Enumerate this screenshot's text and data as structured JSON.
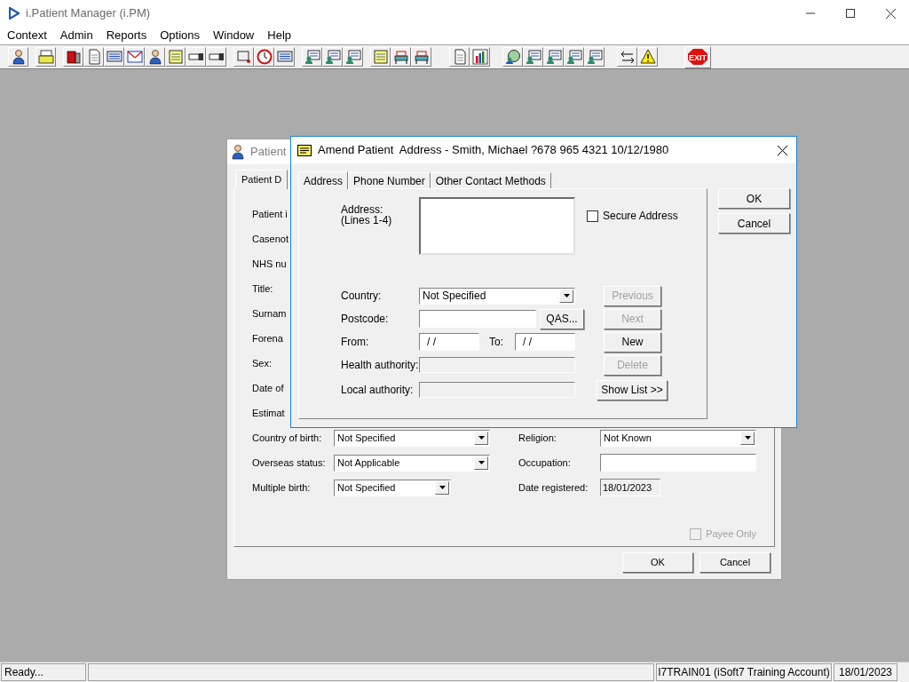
{
  "app": {
    "title": "i.Patient Manager (i.PM)"
  },
  "menu": [
    "Context",
    "Admin",
    "Reports",
    "Options",
    "Window",
    "Help"
  ],
  "toolbar": {
    "exit_label": "EXIT"
  },
  "background_window": {
    "title": "Patient",
    "tabs": [
      {
        "label": "Patient D",
        "selected": true
      }
    ],
    "covered_labels": [
      "Patient i",
      "Casenot",
      "NHS nu",
      "Title:",
      "Surnam",
      "Forena",
      "Sex:",
      "Date of",
      "Estimat"
    ],
    "rows": [
      {
        "left": {
          "label": "Country of birth:",
          "kind": "combo",
          "value": "Not Specified"
        },
        "right": {
          "label": "Religion:",
          "kind": "combo",
          "value": "Not Known"
        }
      },
      {
        "left": {
          "label": "Overseas status:",
          "kind": "combo",
          "value": "Not Applicable"
        },
        "right": {
          "label": "Occupation:",
          "kind": "text"
        }
      },
      {
        "left": {
          "label": "Multiple birth:",
          "kind": "short-combo",
          "value": "Not Specified"
        },
        "right": {
          "label": "Date registered:",
          "kind": "readonly",
          "value": "18/01/2023"
        }
      }
    ],
    "payee_only": {
      "label": "Payee Only",
      "checked": false,
      "disabled": true
    },
    "buttons": [
      "OK",
      "Cancel"
    ]
  },
  "dialog": {
    "title": "Amend Patient  Address - Smith, Michael ?678 965 4321 10/12/1980",
    "tabs": [
      {
        "label": "Address",
        "selected": true
      },
      {
        "label": "Phone Number",
        "selected": false
      },
      {
        "label": "Other Contact Methods",
        "selected": false
      }
    ],
    "address": {
      "label": "Address:",
      "sublabel": "(Lines 1-4)"
    },
    "secure_address": {
      "label": "Secure Address",
      "checked": false
    },
    "country": {
      "label": "Country:",
      "value": "Not Specified"
    },
    "postcode": {
      "label": "Postcode:",
      "button": "QAS..."
    },
    "from": {
      "label": "From:",
      "value": "/ /"
    },
    "to": {
      "label": "To:",
      "value": "/ /"
    },
    "health_authority": {
      "label": "Health authority:",
      "disabled": true
    },
    "local_authority": {
      "label": "Local authority:",
      "disabled": true
    },
    "nav_buttons": [
      {
        "label": "Previous",
        "disabled": true
      },
      {
        "label": "Next",
        "disabled": true
      },
      {
        "label": "New",
        "disabled": false
      },
      {
        "label": "Delete",
        "disabled": true
      }
    ],
    "show_list": "Show List >>",
    "buttons": [
      "OK",
      "Cancel"
    ]
  },
  "status_bar": {
    "message": "Ready...",
    "account": "I7TRAIN01 (iSoft7 Training Account)",
    "date": "18/01/2023"
  }
}
